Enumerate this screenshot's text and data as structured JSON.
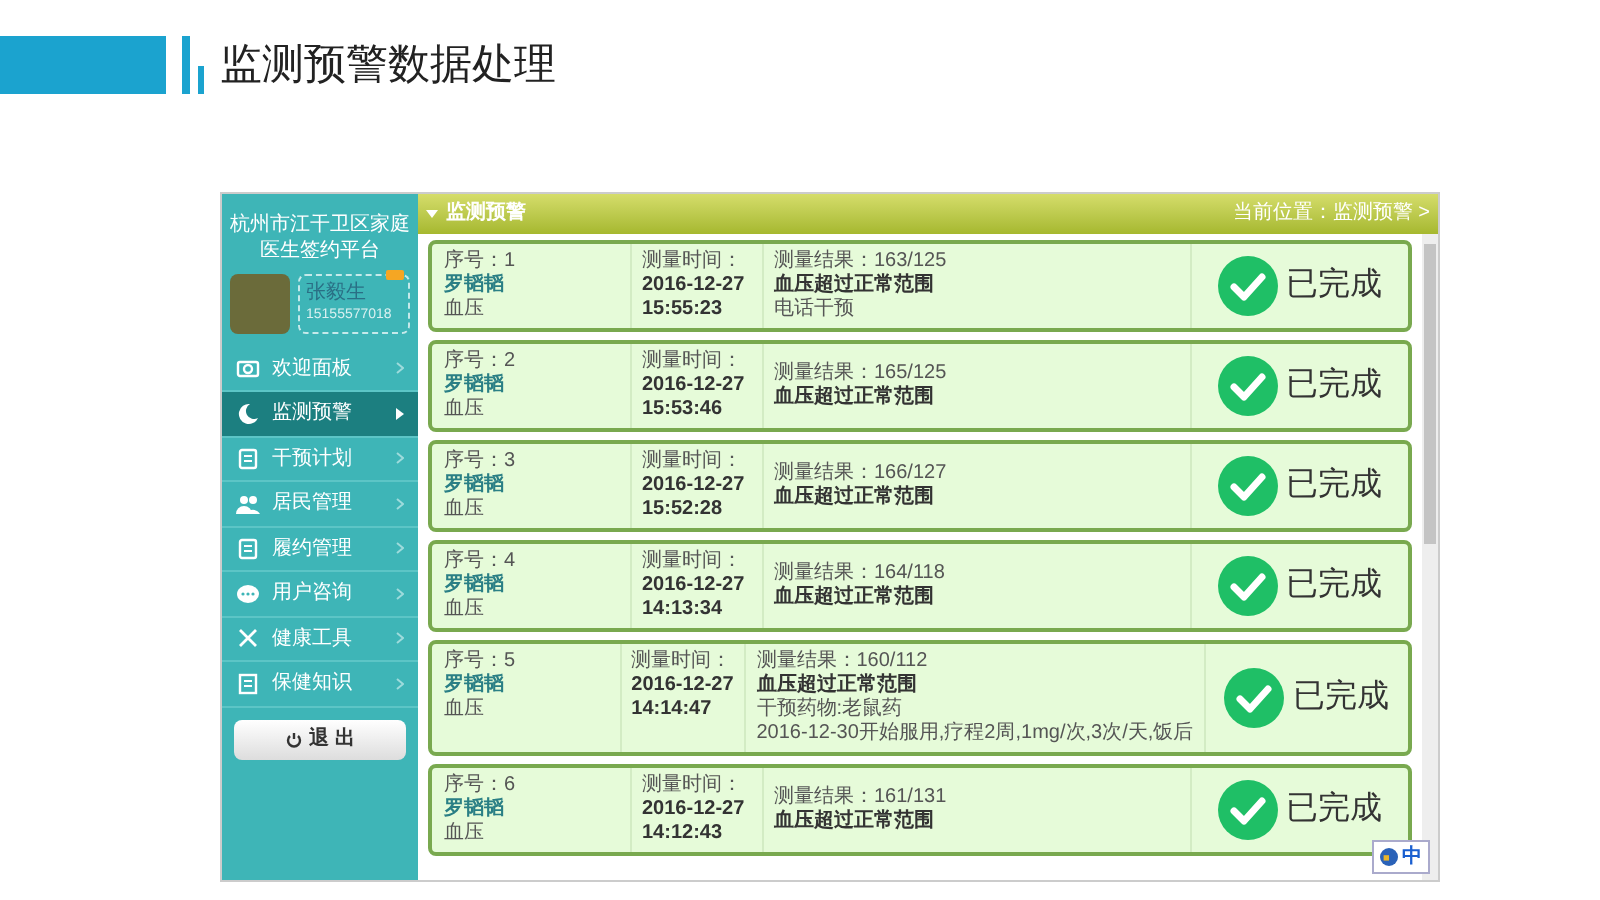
{
  "slide_title": "监测预警数据处理",
  "sidebar": {
    "org_title": "杭州市江干卫区家庭医生签约平台",
    "doctor_name": "张毅生",
    "doctor_phone": "15155577018",
    "items": [
      {
        "label": "欢迎面板",
        "selected": false
      },
      {
        "label": "监测预警",
        "selected": true
      },
      {
        "label": "干预计划",
        "selected": false
      },
      {
        "label": "居民管理",
        "selected": false
      },
      {
        "label": "履约管理",
        "selected": false
      },
      {
        "label": "用户咨询",
        "selected": false
      },
      {
        "label": "健康工具",
        "selected": false
      },
      {
        "label": "保健知识",
        "selected": false
      }
    ],
    "logout_button": "退 出"
  },
  "panel": {
    "title": "监测预警",
    "breadcrumb": "当前位置：监测预警 >"
  },
  "records": [
    {
      "seq": "序号：1",
      "name": "罗韬韬",
      "type": "血压",
      "time_label": "测量时间：",
      "date": "2016-12-27",
      "time": "15:55:23",
      "result": "测量结果：163/125",
      "alert": "血压超过正常范围",
      "notes": [
        "电话干预"
      ],
      "status": "已完成"
    },
    {
      "seq": "序号：2",
      "name": "罗韬韬",
      "type": "血压",
      "time_label": "测量时间：",
      "date": "2016-12-27",
      "time": "15:53:46",
      "result": "测量结果：165/125",
      "alert": "血压超过正常范围",
      "status": "已完成"
    },
    {
      "seq": "序号：3",
      "name": "罗韬韬",
      "type": "血压",
      "time_label": "测量时间：",
      "date": "2016-12-27",
      "time": "15:52:28",
      "result": "测量结果：166/127",
      "alert": "血压超过正常范围",
      "status": "已完成"
    },
    {
      "seq": "序号：4",
      "name": "罗韬韬",
      "type": "血压",
      "time_label": "测量时间：",
      "date": "2016-12-27",
      "time": "14:13:34",
      "result": "测量结果：164/118",
      "alert": "血压超过正常范围",
      "status": "已完成"
    },
    {
      "seq": "序号：5",
      "name": "罗韬韬",
      "type": "血压",
      "time_label": "测量时间：",
      "date": "2016-12-27",
      "time": "14:14:47",
      "result": "测量结果：160/112",
      "alert": "血压超过正常范围",
      "notes": [
        "干预药物:老鼠药",
        "2016-12-30开始服用,疗程2周,1mg/次,3次/天,饭后"
      ],
      "status": "已完成"
    },
    {
      "seq": "序号：6",
      "name": "罗韬韬",
      "type": "血压",
      "time_label": "测量时间：",
      "date": "2016-12-27",
      "time": "14:12:43",
      "result": "测量结果：161/131",
      "alert": "血压超过正常范围",
      "status": "已完成"
    }
  ],
  "ime_indicator": "中"
}
